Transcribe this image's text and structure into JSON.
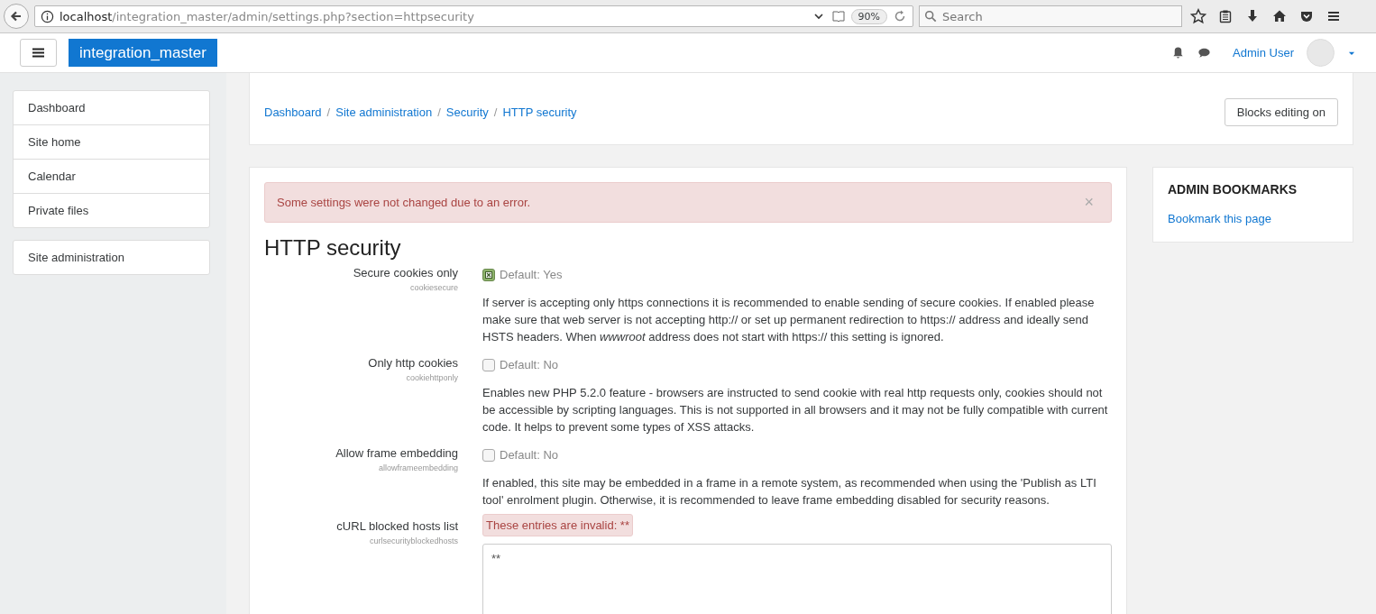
{
  "browser": {
    "url_host": "localhost",
    "url_path": "/integration_master/admin/settings.php?section=httpsecurity",
    "zoom": "90%",
    "search_placeholder": "Search"
  },
  "navbar": {
    "brand": "integration_master",
    "user": "Admin User"
  },
  "sidebar": {
    "groups": [
      [
        "Dashboard",
        "Site home",
        "Calendar",
        "Private files"
      ],
      [
        "Site administration"
      ]
    ]
  },
  "header": {
    "breadcrumbs": [
      "Dashboard",
      "Site administration",
      "Security",
      "HTTP security"
    ],
    "separator": "/",
    "button": "Blocks editing on"
  },
  "alert": {
    "text": "Some settings were not changed due to an error.",
    "close": "×"
  },
  "section_title": "HTTP security",
  "settings": [
    {
      "kind": "checkbox",
      "label": "Secure cookies only",
      "name": "cookiesecure",
      "checked": true,
      "default": "Default: Yes",
      "description": "If server is accepting only https connections it is recommended to enable sending of secure cookies. If enabled please make sure that web server is not accepting http:// or set up permanent redirection to https:// address and ideally send HSTS headers. When *wwwroot* address does not start with https:// this setting is ignored."
    },
    {
      "kind": "checkbox",
      "label": "Only http cookies",
      "name": "cookiehttponly",
      "checked": false,
      "default": "Default: No",
      "description": "Enables new PHP 5.2.0 feature - browsers are instructed to send cookie with real http requests only, cookies should not be accessible by scripting languages. This is not supported in all browsers and it may not be fully compatible with current code. It helps to prevent some types of XSS attacks."
    },
    {
      "kind": "checkbox",
      "label": "Allow frame embedding",
      "name": "allowframeembedding",
      "checked": false,
      "default": "Default: No",
      "description": "If enabled, this site may be embedded in a frame in a remote system, as recommended when using the 'Publish as LTI tool' enrolment plugin. Otherwise, it is recommended to leave frame embedding disabled for security reasons."
    },
    {
      "kind": "textarea",
      "label": "cURL blocked hosts list",
      "name": "curlsecurityblockedhosts",
      "error": "These entries are invalid: **",
      "value": "**"
    }
  ],
  "block": {
    "title": "ADMIN BOOKMARKS",
    "link": "Bookmark this page"
  }
}
